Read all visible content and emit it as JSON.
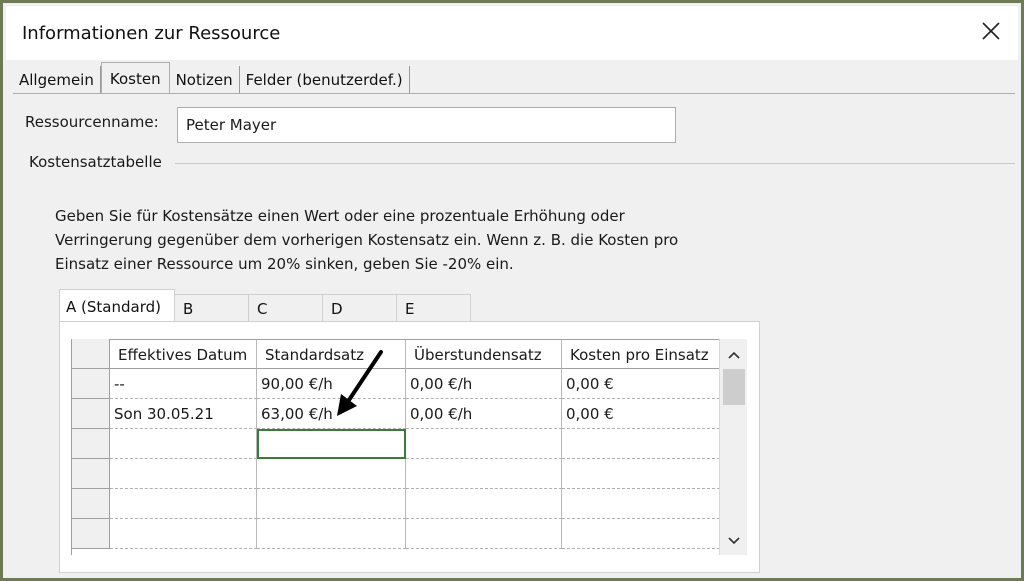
{
  "dialog": {
    "title": "Informationen zur Ressource",
    "close_icon": "close-icon"
  },
  "tabs": [
    {
      "label": "Allgemein",
      "active": false
    },
    {
      "label": "Kosten",
      "active": true
    },
    {
      "label": "Notizen",
      "active": false
    },
    {
      "label": "Felder (benutzerdef.)",
      "active": false
    }
  ],
  "resource": {
    "name_label": "Ressourcenname:",
    "name_value": "Peter Mayer"
  },
  "cost_table": {
    "group_label": "Kostensatztabelle",
    "description": [
      "Geben Sie für Kostensätze einen Wert oder eine prozentuale Erhöhung oder",
      "Verringerung gegenüber dem vorherigen Kostensatz ein. Wenn z. B. die Kosten pro",
      "Einsatz einer Ressource um 20% sinken, geben Sie -20% ein."
    ],
    "rate_tabs": [
      "A (Standard)",
      "B",
      "C",
      "D",
      "E"
    ],
    "active_rate_tab": "A (Standard)",
    "columns": [
      "Effektives Datum",
      "Standardsatz",
      "Überstundensatz",
      "Kosten pro Einsatz"
    ],
    "rows": [
      [
        "--",
        "90,00 €/h",
        "0,00 €/h",
        "0,00 €"
      ],
      [
        "Son 30.05.21",
        "63,00 €/h",
        "0,00 €/h",
        "0,00 €"
      ],
      [
        "",
        "",
        "",
        ""
      ],
      [
        "",
        "",
        "",
        ""
      ],
      [
        "",
        "",
        "",
        ""
      ],
      [
        "",
        "",
        "",
        ""
      ]
    ]
  },
  "colors": {
    "frame_border": "#6e7a56",
    "selected_cell": "#3d7a3d",
    "annotation_arrow": "#000000"
  }
}
